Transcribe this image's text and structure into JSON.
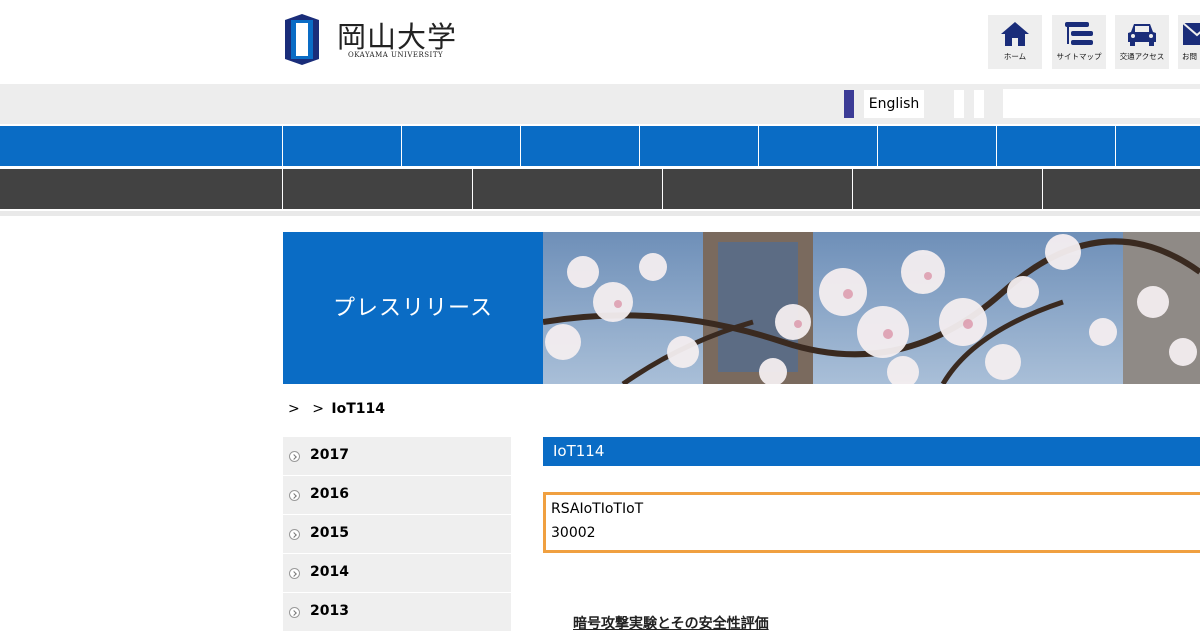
{
  "header": {
    "logo_title": "岡山大学",
    "logo_subtitle": "OKAYAMA UNIVERSITY",
    "nav_buttons": [
      {
        "label": "ホーム",
        "icon": "home-icon"
      },
      {
        "label": "サイトマップ",
        "icon": "sitemap-icon"
      },
      {
        "label": "交通アクセス",
        "icon": "car-icon"
      },
      {
        "label": "お問",
        "icon": "mail-icon"
      }
    ]
  },
  "utility_bar": {
    "language_link": "English",
    "search_placeholder": ""
  },
  "hero": {
    "label": "プレスリリース"
  },
  "breadcrumb": {
    "sep1": ">",
    "sep2": ">",
    "current": "IoT114"
  },
  "sidebar": {
    "years": [
      "2017",
      "2016",
      "2015",
      "2014",
      "2013"
    ]
  },
  "article": {
    "title": "IoT114",
    "notice_line1": "RSAIoTIoTIoT",
    "notice_line2": "30002",
    "section_link": "暗号攻撃実験とその安全性評価"
  },
  "colors": {
    "brand_blue": "#0a6cc5",
    "dark_nav": "#424242",
    "notice_border": "#f0a040",
    "language_marker": "#3c3c96"
  }
}
